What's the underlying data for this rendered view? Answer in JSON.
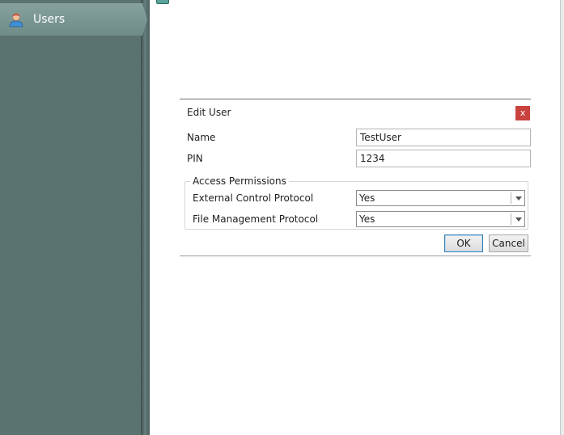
{
  "nav": {
    "items": [
      {
        "label": "Users",
        "icon": "user-icon"
      }
    ]
  },
  "dialog": {
    "title": "Edit User",
    "close_label": "x",
    "fields": {
      "name": {
        "label": "Name",
        "value": "TestUser"
      },
      "pin": {
        "label": "PIN",
        "value": "1234"
      }
    },
    "permissions": {
      "title": "Access Permissions",
      "items": [
        {
          "label": "External Control Protocol",
          "value": "Yes"
        },
        {
          "label": "File Management Protocol",
          "value": "Yes"
        }
      ]
    },
    "ok_label": "OK",
    "cancel_label": "Cancel"
  },
  "colors": {
    "nav_background": "#5a7370",
    "nav_item_active": "#7d9895",
    "close_button": "#c9423e",
    "ok_button_border": "#3c7fb1",
    "tab_accent": "#5aa29a"
  }
}
